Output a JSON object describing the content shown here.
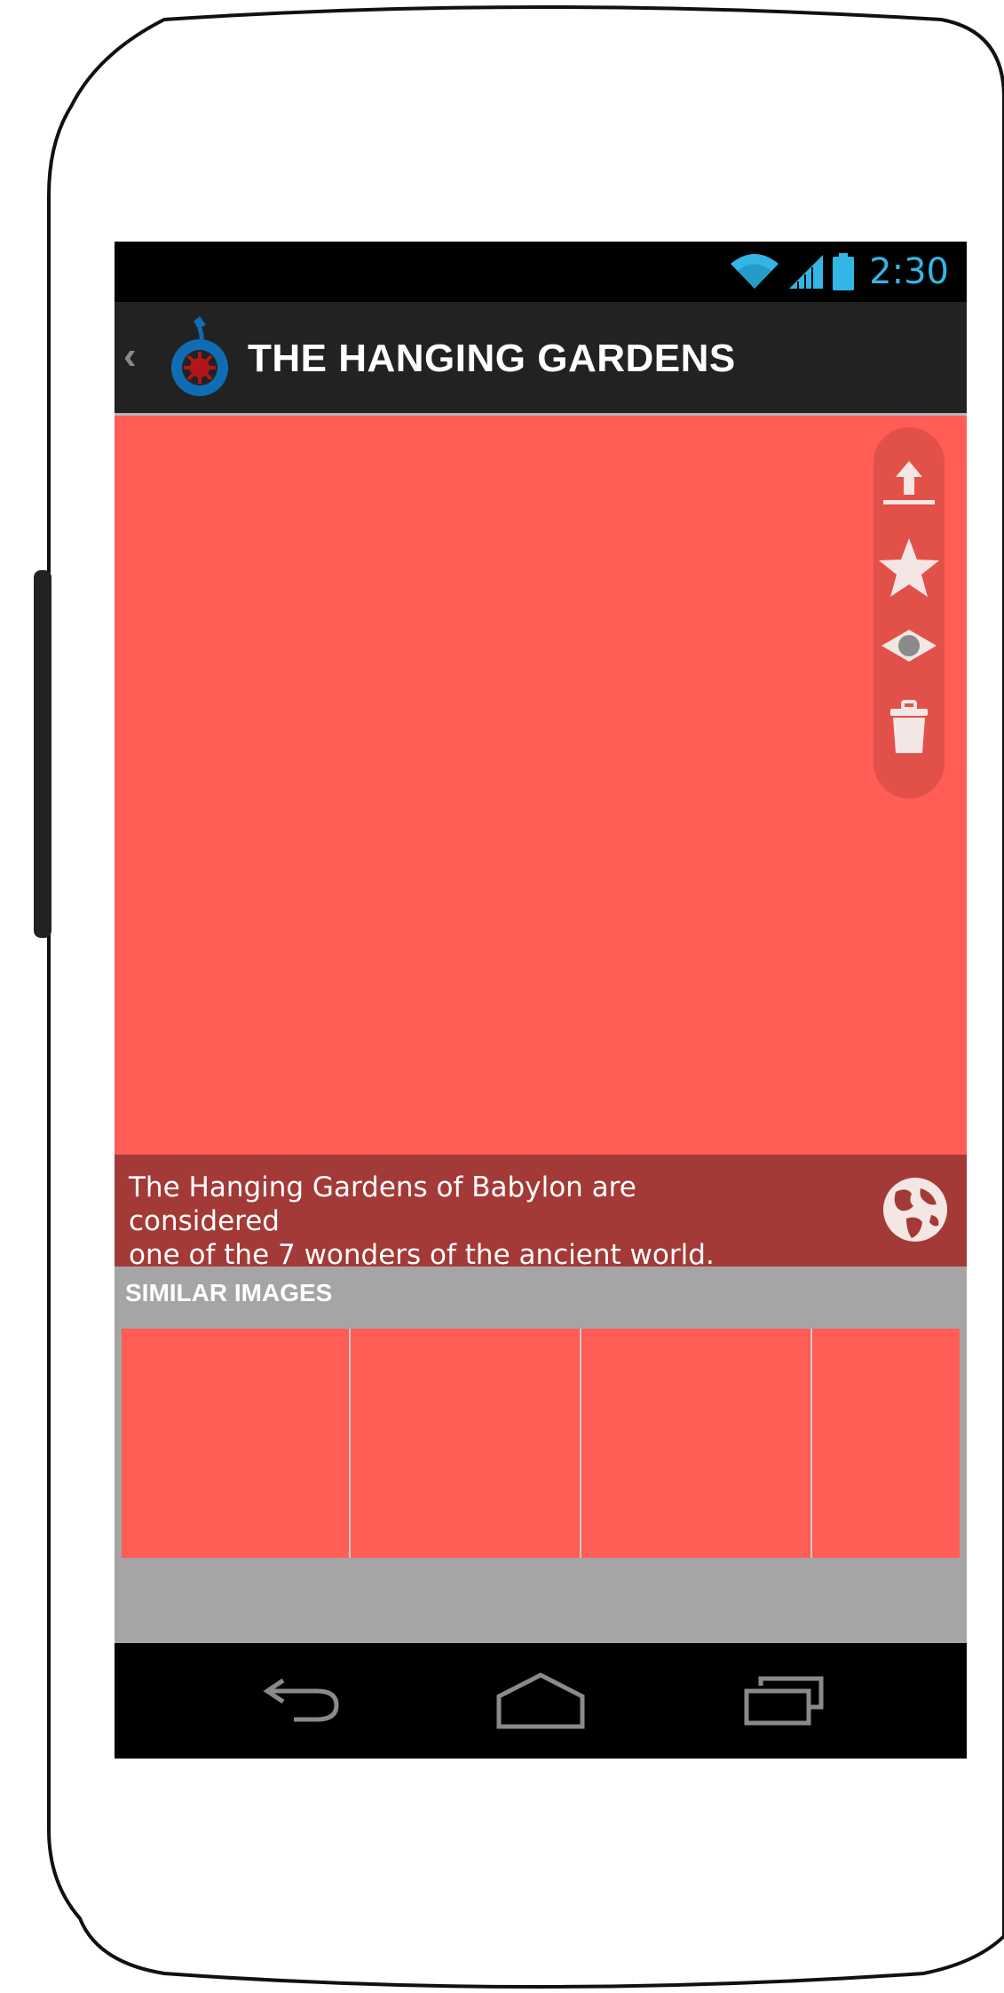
{
  "status_bar": {
    "time": "2:30",
    "icons": [
      "wifi-icon",
      "signal-icon",
      "battery-icon"
    ],
    "accent_color": "#33b5e5"
  },
  "action_bar": {
    "title": "THE HANGING GARDENS",
    "logo": "wikimedia-commons-logo"
  },
  "image_viewer": {
    "background_color": "#ff5d55",
    "actions": [
      {
        "name": "upload-icon"
      },
      {
        "name": "star-icon"
      },
      {
        "name": "eye-icon"
      },
      {
        "name": "trash-icon"
      }
    ]
  },
  "caption": {
    "line1": "The Hanging Gardens of Babylon are considered",
    "line2": "one of the 7 wonders of the ancient world.",
    "icon": "globe-icon",
    "color": "#a33a37"
  },
  "similar_images": {
    "header": "SIMILAR IMAGES",
    "count_visible": 4
  },
  "nav_bar": {
    "buttons": [
      "back-icon",
      "home-icon",
      "recents-icon"
    ]
  }
}
